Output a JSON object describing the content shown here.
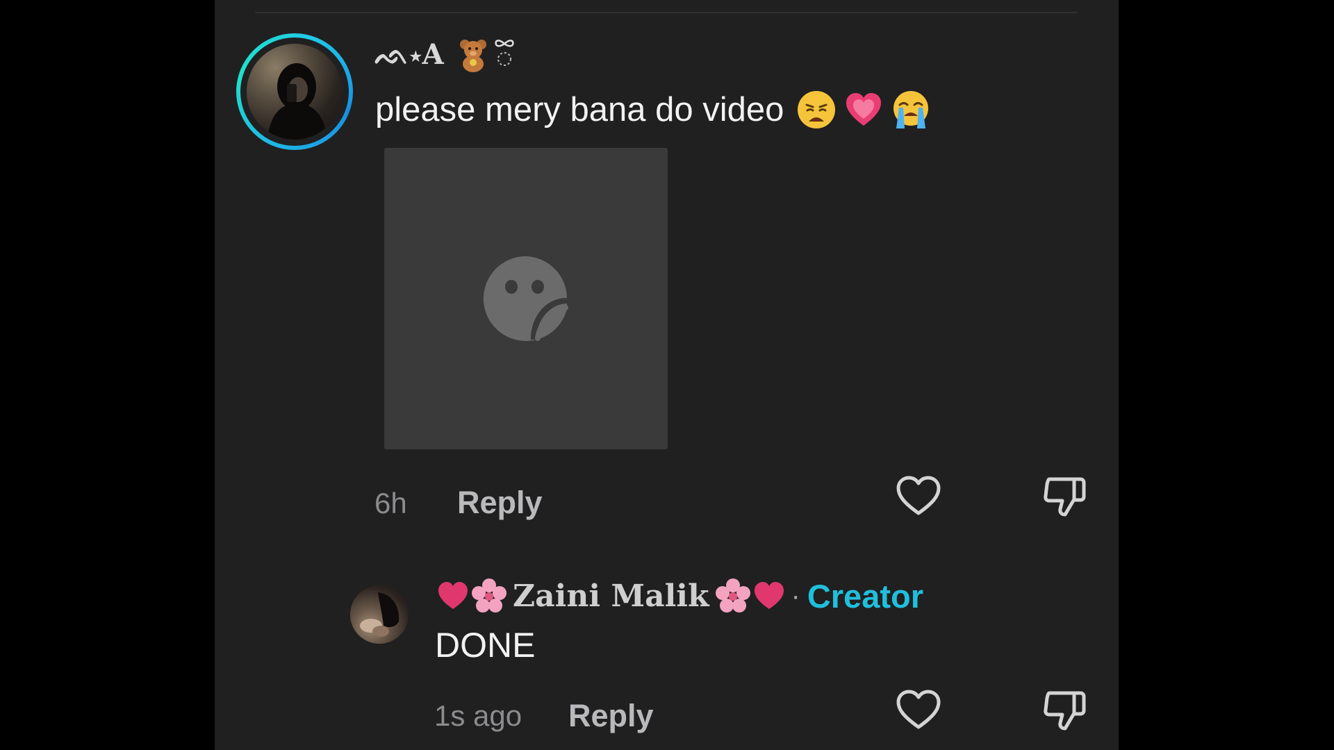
{
  "main_comment": {
    "username": "ᨒ⋆A",
    "username_icons": [
      "teddy-bear-icon",
      "bow-icon"
    ],
    "text": "please mery bana do video",
    "emojis": [
      "weary-face-icon",
      "growing-heart-icon",
      "crying-face-icon"
    ],
    "sticker": "unavailable-sticker-icon",
    "time": "6h",
    "reply_label": "Reply"
  },
  "reply_comment": {
    "username": "Zaini Malik",
    "username_icons": [
      "heart-icon",
      "cherry-blossom-icon",
      "cherry-blossom-icon",
      "heart-icon"
    ],
    "separator": "·",
    "badge": "Creator",
    "text": "DONE",
    "time": "1s ago",
    "reply_label": "Reply"
  },
  "colors": {
    "background": "#000000",
    "panel": "#202021",
    "creator_accent": "#20bfdc",
    "avatar_ring": "#1fb6e6"
  }
}
